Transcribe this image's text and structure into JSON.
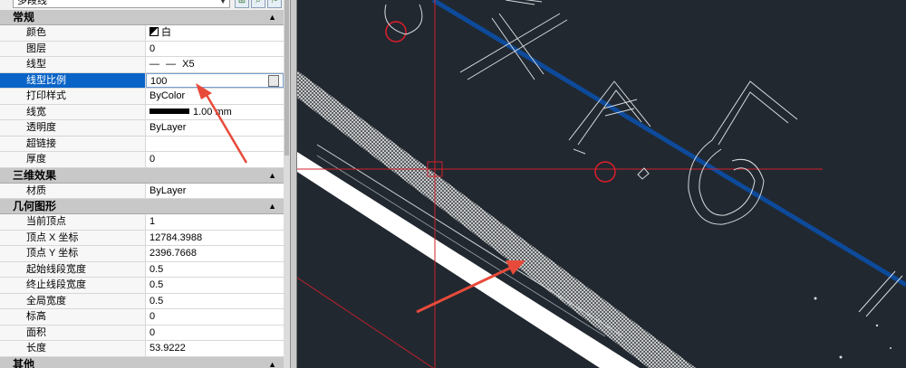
{
  "toolbar": {
    "object_type": "多段线"
  },
  "sections": {
    "general": {
      "title": "常规",
      "rows": [
        {
          "key": "颜色",
          "value": "白"
        },
        {
          "key": "图层",
          "value": "0"
        },
        {
          "key": "线型",
          "value": "X5"
        },
        {
          "key": "线型比例",
          "value": "100"
        },
        {
          "key": "打印样式",
          "value": "ByColor"
        },
        {
          "key": "线宽",
          "value": "1.00 mm"
        },
        {
          "key": "透明度",
          "value": "ByLayer"
        },
        {
          "key": "超链接",
          "value": ""
        },
        {
          "key": "厚度",
          "value": "0"
        }
      ]
    },
    "3d": {
      "title": "三维效果",
      "rows": [
        {
          "key": "材质",
          "value": "ByLayer"
        }
      ]
    },
    "geometry": {
      "title": "几何图形",
      "rows": [
        {
          "key": "当前顶点",
          "value": "1"
        },
        {
          "key": "顶点 X 坐标",
          "value": "12784.3988"
        },
        {
          "key": "顶点 Y 坐标",
          "value": "2396.7668"
        },
        {
          "key": "起始线段宽度",
          "value": "0.5"
        },
        {
          "key": "终止线段宽度",
          "value": "0.5"
        },
        {
          "key": "全局宽度",
          "value": "0.5"
        },
        {
          "key": "标高",
          "value": "0"
        },
        {
          "key": "面积",
          "value": "0"
        },
        {
          "key": "长度",
          "value": "53.9222"
        }
      ]
    },
    "misc": {
      "title": "其他"
    }
  },
  "colors": {
    "selected_row": "#0a64c8",
    "drawing_bg": "#212830",
    "annotation_arrow": "#e84a3a",
    "blue_line": "#0d4a9a"
  }
}
